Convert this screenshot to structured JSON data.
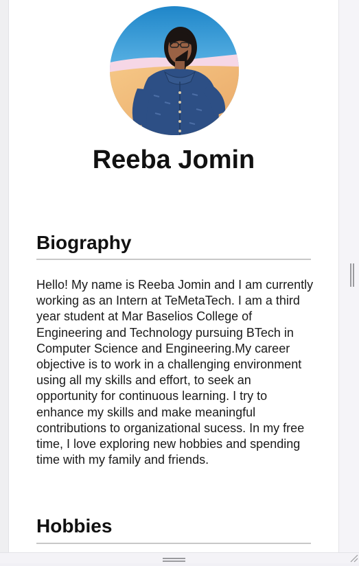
{
  "profile": {
    "name": "Reeba Jomin"
  },
  "biography": {
    "heading": "Biography",
    "text": "Hello! My name is Reeba Jomin and I am currently working as an Intern at TeMetaTech. I am a third year student at Mar Baselios College of Engineering and Technology pursuing BTech in Computer Science and Engineering.My career objective is to work in a challenging environment using all my skills and effort, to seek an opportunity for continuous learning. I try to enhance my skills and make meaningful contributions to organizational sucess. In my free time, I love exploring new hobbies and spending time with my family and friends."
  },
  "hobbies": {
    "heading": "Hobbies"
  },
  "colors": {
    "page_background": "#f1f0f5",
    "card_background": "#ffffff",
    "text": "#111111",
    "divider": "#c8c8c8"
  }
}
